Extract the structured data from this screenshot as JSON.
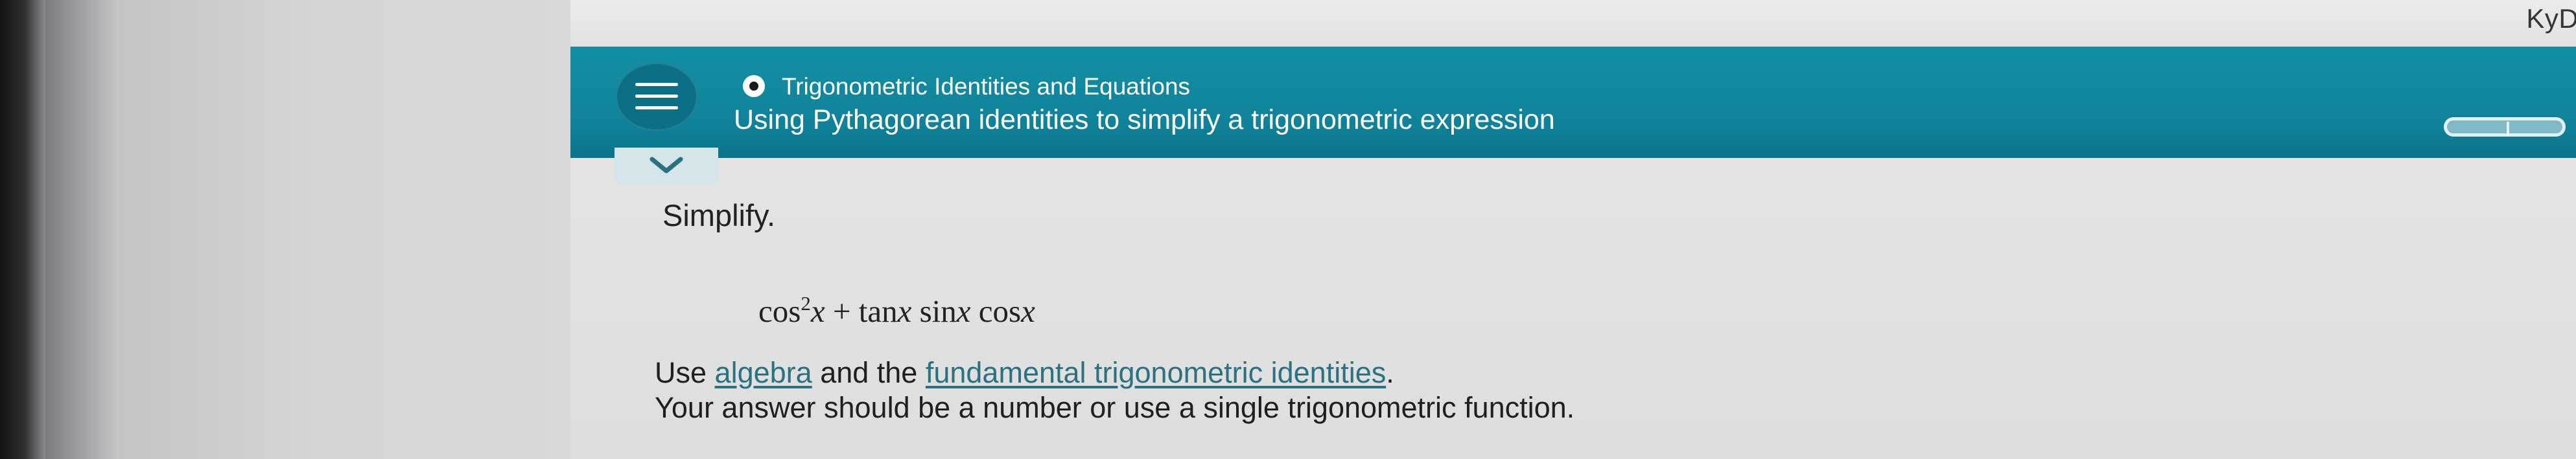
{
  "browser": {
    "url_fragment": "KyD6sW-gISOBKyDkYHfnAJOA3qvJ4wr30BO8db"
  },
  "header": {
    "menu_icon": "hamburger-menu-icon",
    "topic_icon": "radio-dot-icon",
    "topic": "Trigonometric Identities and Equations",
    "title": "Using Pythagorean identities to simplify a trigonometric expression",
    "accent_color": "#148fa4"
  },
  "collapse": {
    "icon": "chevron-down-icon"
  },
  "question": {
    "instruction": "Simplify.",
    "expression": {
      "cos_prefix": "cos",
      "power": "2",
      "x1": "x",
      "plus": "+",
      "tan": "tan",
      "x2": "x",
      "sin": "sin",
      "x3": "x",
      "cos": "cos",
      "x4": "x"
    },
    "line1_prefix": "Use",
    "algebra_link": "algebra",
    "line1_middle": "and the",
    "identities_link": "fundamental trigonometric identities",
    "line1_suffix": ".",
    "line2": "Your answer should be a number or use a single trigonometric function."
  }
}
